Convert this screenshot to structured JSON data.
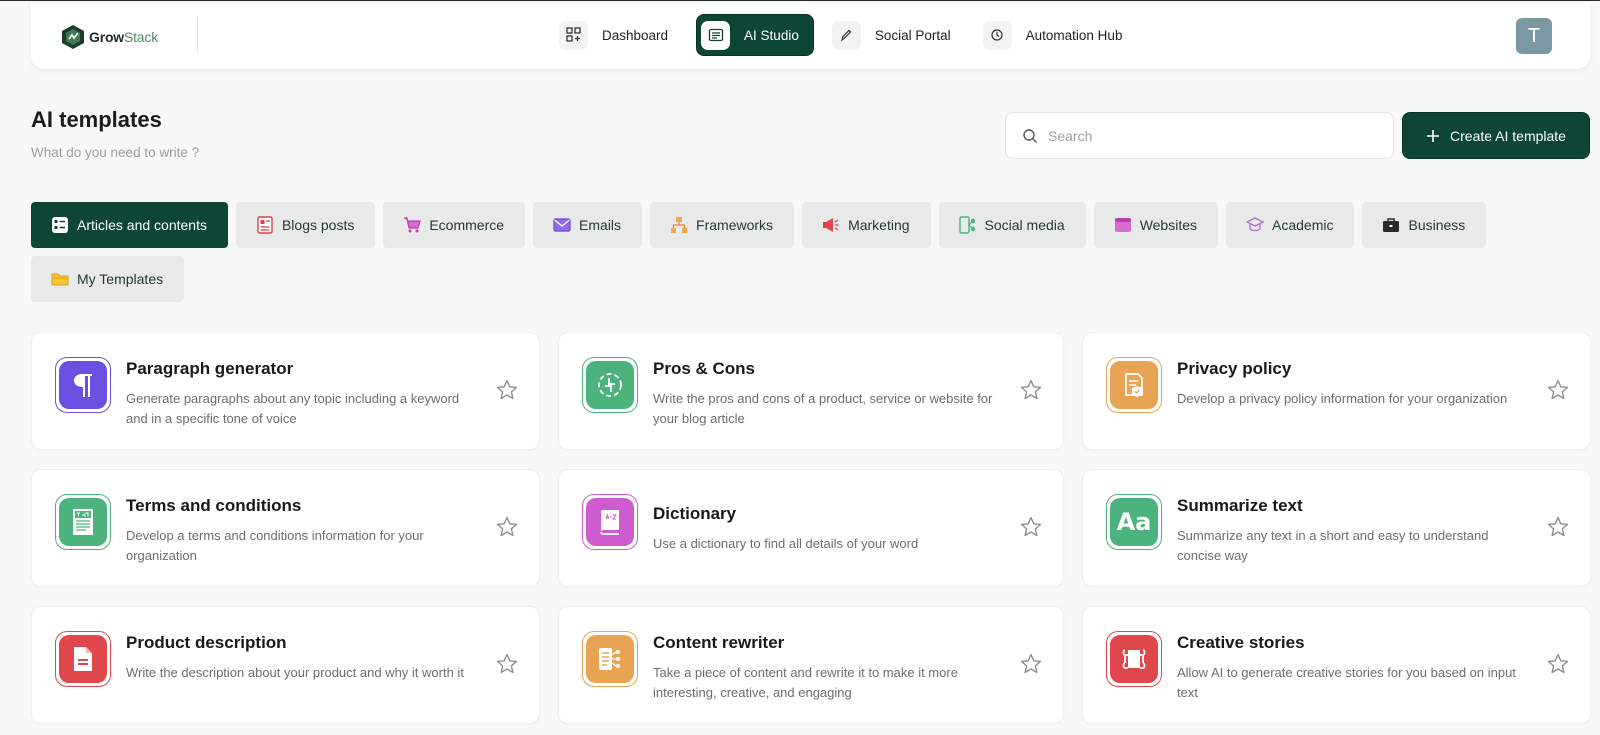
{
  "brand": {
    "name_bold": "Grow",
    "name_light": "Stack"
  },
  "nav": [
    {
      "label": "Dashboard",
      "icon": "dashboard-icon",
      "active": false
    },
    {
      "label": "AI Studio",
      "icon": "ai-studio-icon",
      "active": true
    },
    {
      "label": "Social Portal",
      "icon": "pen-icon",
      "active": false
    },
    {
      "label": "Automation Hub",
      "icon": "clock-icon",
      "active": false
    }
  ],
  "user": {
    "avatar_letter": "T"
  },
  "header": {
    "title": "AI templates",
    "subtitle": "What do you need to write ?"
  },
  "search": {
    "placeholder": "Search",
    "value": ""
  },
  "create_button": {
    "label": "Create AI template"
  },
  "categories": [
    {
      "label": "Articles and contents",
      "icon": "list-icon",
      "active": true
    },
    {
      "label": "Blogs posts",
      "icon": "blog-icon",
      "active": false
    },
    {
      "label": "Ecommerce",
      "icon": "cart-icon",
      "active": false
    },
    {
      "label": "Emails",
      "icon": "email-icon",
      "active": false
    },
    {
      "label": "Frameworks",
      "icon": "hierarchy-icon",
      "active": false
    },
    {
      "label": "Marketing",
      "icon": "megaphone-icon",
      "active": false
    },
    {
      "label": "Social media",
      "icon": "social-icon",
      "active": false
    },
    {
      "label": "Websites",
      "icon": "browser-icon",
      "active": false
    },
    {
      "label": "Academic",
      "icon": "graduation-cap-icon",
      "active": false
    },
    {
      "label": "Business",
      "icon": "briefcase-icon",
      "active": false
    },
    {
      "label": "My Templates",
      "icon": "folder-icon",
      "active": false
    }
  ],
  "templates": [
    {
      "title": "Paragraph generator",
      "description": "Generate paragraphs about any topic including a keyword and in a specific tone of voice",
      "icon": "paragraph-icon",
      "color": "#6b4fe0"
    },
    {
      "title": "Pros & Cons",
      "description": "Write the pros and cons of a product, service or website for your blog article",
      "icon": "thumbs-icon",
      "color": "#4db37e"
    },
    {
      "title": "Privacy policy",
      "description": "Develop a privacy policy information for your organization",
      "icon": "document-shield-icon",
      "color": "#e8a452"
    },
    {
      "title": "Terms and conditions",
      "description": "Develop a terms and conditions information for your organization",
      "icon": "terms-icon",
      "color": "#4db37e"
    },
    {
      "title": "Dictionary",
      "description": "Use a dictionary to find all details of your word",
      "icon": "book-icon",
      "color": "#cf5ccf"
    },
    {
      "title": "Summarize text",
      "description": "Summarize any text in a short and easy to understand concise way",
      "icon": "font-size-icon",
      "color": "#4db37e"
    },
    {
      "title": "Product description",
      "description": "Write the description about your product and why it worth it",
      "icon": "file-icon",
      "color": "#e0474c"
    },
    {
      "title": "Content rewriter",
      "description": "Take a piece of content and rewrite it to make it more interesting, creative, and engaging",
      "icon": "rewrite-icon",
      "color": "#e8a452"
    },
    {
      "title": "Creative stories",
      "description": "Allow AI to generate creative stories for you based on input text",
      "icon": "scroll-icon",
      "color": "#e0474c"
    }
  ]
}
